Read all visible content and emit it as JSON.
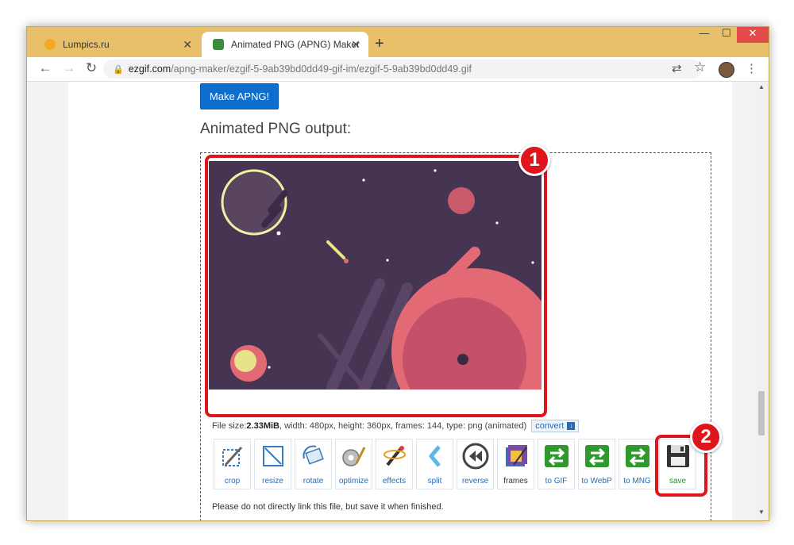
{
  "browser": {
    "tabs": [
      {
        "title": "Lumpics.ru",
        "active": false
      },
      {
        "title": "Animated PNG (APNG) Maker",
        "active": true
      }
    ],
    "url": {
      "host": "ezgif.com",
      "path": "/apng-maker/ezgif-5-9ab39bd0dd49-gif-im/ezgif-5-9ab39bd0dd49.gif"
    },
    "window_controls": {
      "minimize": "—",
      "maximize": "☐",
      "close": "✕"
    },
    "nav": {
      "back": "←",
      "forward": "→",
      "reload": "↻",
      "new_tab": "+"
    },
    "icons": {
      "translate": "⇄",
      "star": "☆",
      "menu": "⋮"
    }
  },
  "page": {
    "make_button_label": "Make APNG!",
    "output_heading": "Animated PNG output:",
    "file_info": {
      "prefix": "File size: ",
      "size": "2.33MiB",
      "details": ", width: 480px, height: 360px, frames: 144, type: png (animated)",
      "convert_label": "convert"
    },
    "tools": [
      {
        "label": "crop",
        "icon": "crop-icon"
      },
      {
        "label": "resize",
        "icon": "resize-icon"
      },
      {
        "label": "rotate",
        "icon": "rotate-icon"
      },
      {
        "label": "optimize",
        "icon": "optimize-icon"
      },
      {
        "label": "effects",
        "icon": "effects-icon"
      },
      {
        "label": "split",
        "icon": "split-icon"
      },
      {
        "label": "reverse",
        "icon": "reverse-icon"
      },
      {
        "label": "frames",
        "icon": "frames-icon"
      },
      {
        "label": "to GIF",
        "icon": "convert-arrows-icon"
      },
      {
        "label": "to WebP",
        "icon": "convert-arrows-icon"
      },
      {
        "label": "to MNG",
        "icon": "convert-arrows-icon"
      },
      {
        "label": "save",
        "icon": "floppy-disk-icon"
      }
    ],
    "notice": "Please do not directly link this file, but save it when finished."
  },
  "annotations": {
    "badge_1": "1",
    "badge_2": "2",
    "highlight_color": "#e0151b"
  }
}
